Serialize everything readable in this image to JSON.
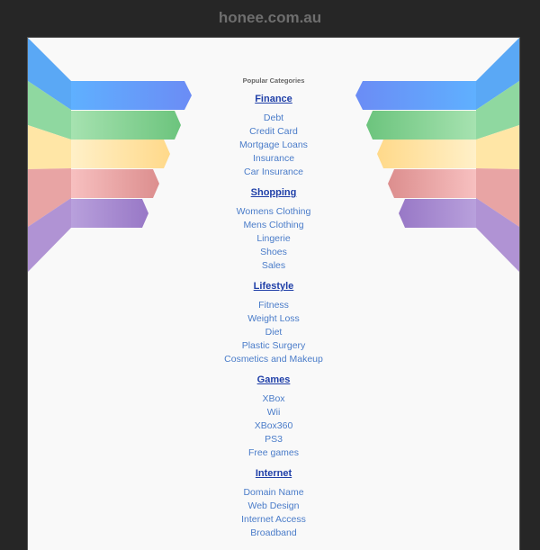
{
  "header": {
    "site_name": "honee.com.au"
  },
  "popular_title": "Popular Categories",
  "colors": {
    "background": "#262626",
    "panel": "#f9f9f9",
    "heading_link": "#1f3fa8",
    "item_link": "#4a7cc9",
    "wing_blue": "#6aa6ff",
    "wing_green": "#7fd18d",
    "wing_yellow": "#ffe29a",
    "wing_red": "#e99a9a",
    "wing_purple": "#a98ed0"
  },
  "categories": [
    {
      "title": "Finance",
      "items": [
        "Debt",
        "Credit Card",
        "Mortgage Loans",
        "Insurance",
        "Car Insurance"
      ]
    },
    {
      "title": "Shopping",
      "items": [
        "Womens Clothing",
        "Mens Clothing",
        "Lingerie",
        "Shoes",
        "Sales"
      ]
    },
    {
      "title": "Lifestyle",
      "items": [
        "Fitness",
        "Weight Loss",
        "Diet",
        "Plastic Surgery",
        "Cosmetics and Makeup"
      ]
    },
    {
      "title": "Games",
      "items": [
        "XBox",
        "Wii",
        "XBox360",
        "PS3",
        "Free games"
      ]
    },
    {
      "title": "Internet",
      "items": [
        "Domain Name",
        "Web Design",
        "Internet Access",
        "Broadband"
      ]
    }
  ]
}
